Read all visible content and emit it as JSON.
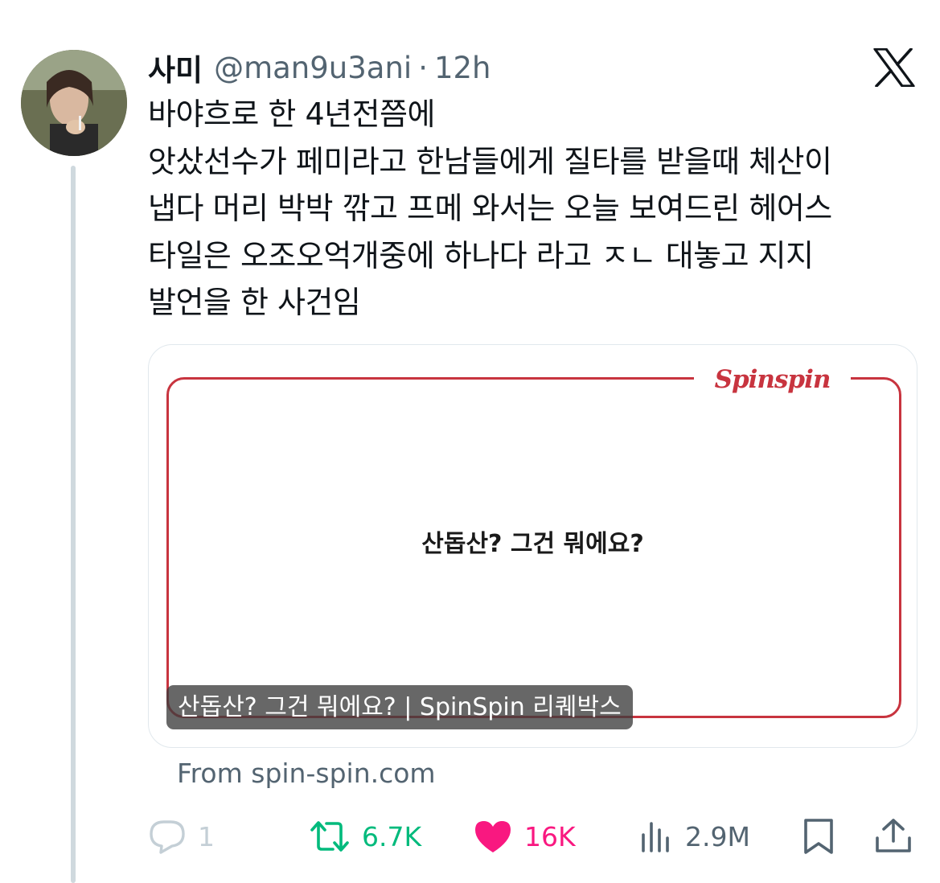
{
  "tweet": {
    "display_name": "사미",
    "handle": "@man9u3ani",
    "separator": "·",
    "time": "12h",
    "text": "바야흐로 한 4년전쯤에\n앗샀선수가 페미라고 한남들에게 질타를 받을때 체산이\n냅다 머리 박박 깎고 프메 와서는 오늘 보여드린 헤어스\n타일은 오조오억개중에 하나다 라고 ㅈㄴ 대놓고 지지\n발언을 한 사건임"
  },
  "card": {
    "brand": "Spinspin",
    "center_text": "산돕산? 그건 뭐에요?",
    "caption": "산돕산? 그건 뭐에요? | SpinSpin 리퀘박스",
    "source": "From spin-spin.com",
    "frame_color": "#c8343f"
  },
  "actions": {
    "reply": {
      "icon": "reply-icon",
      "count": "1"
    },
    "retweet": {
      "icon": "retweet-icon",
      "count": "6.7K",
      "color": "#00ba7c"
    },
    "like": {
      "icon": "heart-icon",
      "count": "16K",
      "color": "#f91880"
    },
    "views": {
      "icon": "views-icon",
      "count": "2.9M"
    },
    "bookmark": {
      "icon": "bookmark-icon"
    },
    "share": {
      "icon": "share-icon"
    }
  },
  "icons": {
    "platform_logo": "x-logo-icon",
    "avatar": "avatar"
  }
}
